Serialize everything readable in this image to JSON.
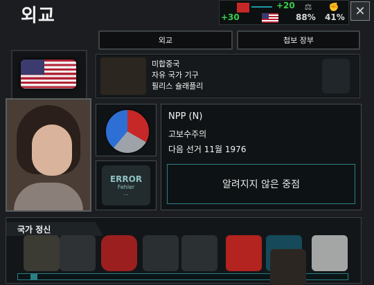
{
  "header": {
    "title": "외교",
    "stat_plus20": "+20",
    "stat_plus30": "+30",
    "stat_pct1": "88%",
    "stat_pct2": "41%",
    "close_glyph": "✕"
  },
  "tabs": {
    "diplomacy": "외교",
    "intel": "첩보 장부"
  },
  "country": {
    "name": "미합중국",
    "ideology_line": "자유 국가 기구",
    "leader": "필리스 슐래플리"
  },
  "party": {
    "name": "NPP (N)",
    "ideology": "고보수주의",
    "next_election": "다음 선거 11월 1976",
    "focus": "알려지지 않은 중점"
  },
  "badge": {
    "line1": "ERROR",
    "line2": "Fehler",
    "line3": "..."
  },
  "national_spirits": {
    "label": "국가 정신",
    "icons": [
      "lamp-icon",
      "soldier-icon",
      "bank-icon",
      "workers-icon",
      "ship-icon",
      "oil-icon",
      "monitor-icon",
      "uncle-sam-icon",
      "capitol-icon"
    ]
  },
  "colors": {
    "accent_green": "#38d04a",
    "accent_teal": "#2a7f86",
    "pie_blue": "#2e6fd6",
    "pie_red": "#c62828",
    "pie_grey": "#9da3a8"
  }
}
